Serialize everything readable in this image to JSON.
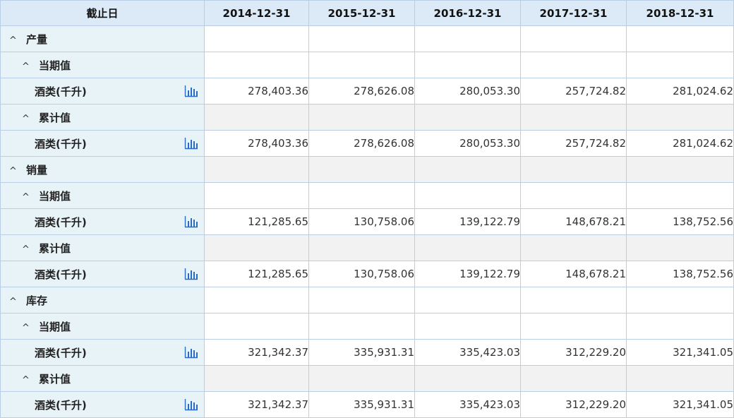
{
  "header": {
    "corner": "截止日",
    "dates": [
      "2014-12-31",
      "2015-12-31",
      "2016-12-31",
      "2017-12-31",
      "2018-12-31"
    ]
  },
  "rows": [
    {
      "type": "group",
      "level": 0,
      "label": "产量",
      "shaded": false
    },
    {
      "type": "group",
      "level": 1,
      "label": "当期值",
      "shaded": false
    },
    {
      "type": "leaf",
      "label": "酒类(千升)",
      "values": [
        "278,403.36",
        "278,626.08",
        "280,053.30",
        "257,724.82",
        "281,024.62"
      ],
      "shaded": false
    },
    {
      "type": "group",
      "level": 1,
      "label": "累计值",
      "shaded": true
    },
    {
      "type": "leaf",
      "label": "酒类(千升)",
      "values": [
        "278,403.36",
        "278,626.08",
        "280,053.30",
        "257,724.82",
        "281,024.62"
      ],
      "shaded": false
    },
    {
      "type": "group",
      "level": 0,
      "label": "销量",
      "shaded": true
    },
    {
      "type": "group",
      "level": 1,
      "label": "当期值",
      "shaded": false
    },
    {
      "type": "leaf",
      "label": "酒类(千升)",
      "values": [
        "121,285.65",
        "130,758.06",
        "139,122.79",
        "148,678.21",
        "138,752.56"
      ],
      "shaded": false
    },
    {
      "type": "group",
      "level": 1,
      "label": "累计值",
      "shaded": true
    },
    {
      "type": "leaf",
      "label": "酒类(千升)",
      "values": [
        "121,285.65",
        "130,758.06",
        "139,122.79",
        "148,678.21",
        "138,752.56"
      ],
      "shaded": false
    },
    {
      "type": "group",
      "level": 0,
      "label": "库存",
      "shaded": false
    },
    {
      "type": "group",
      "level": 1,
      "label": "当期值",
      "shaded": false
    },
    {
      "type": "leaf",
      "label": "酒类(千升)",
      "values": [
        "321,342.37",
        "335,931.31",
        "335,423.03",
        "312,229.20",
        "321,341.05"
      ],
      "shaded": false
    },
    {
      "type": "group",
      "level": 1,
      "label": "累计值",
      "shaded": true
    },
    {
      "type": "leaf",
      "label": "酒类(千升)",
      "values": [
        "321,342.37",
        "335,931.31",
        "335,423.03",
        "312,229.20",
        "321,341.05"
      ],
      "shaded": false
    }
  ],
  "icons": {
    "collapse": "chevron-up-icon",
    "chart": "bar-chart-icon"
  },
  "colors": {
    "header_bg": "#dce9f7",
    "label_bg": "#e8f3f8",
    "shaded_bg": "#f2f2f2",
    "border": "#b9cde5",
    "icon": "#2a6cc4"
  }
}
